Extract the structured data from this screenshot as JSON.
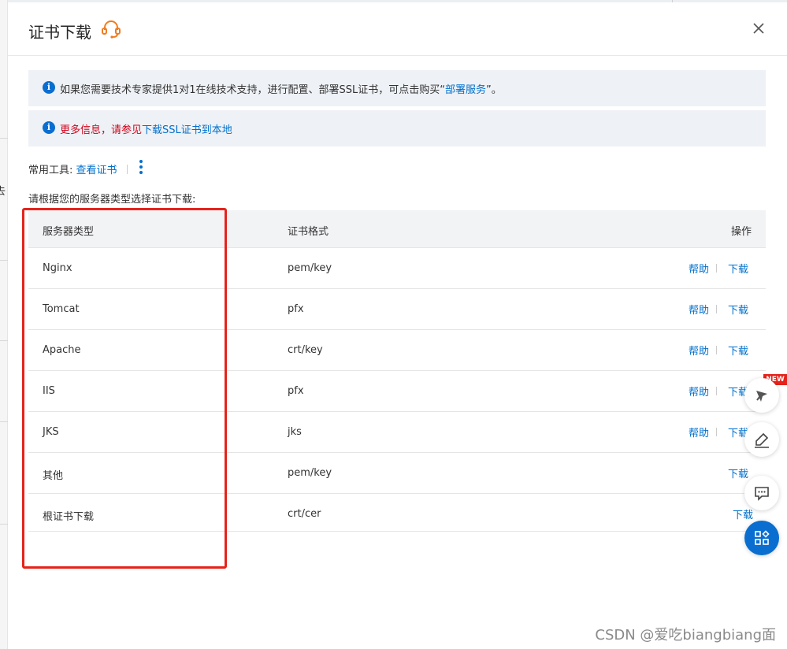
{
  "dialog": {
    "title": "证书下载",
    "notices": [
      {
        "prefix": "如果您需要技术专家提供1对1在线技术支持，进行配置、部署SSL证书，可点击购买“",
        "link": "部署服务",
        "suffix": "”。"
      },
      {
        "prefix": "更多信息，请参见",
        "link": "下载SSL证书到本地"
      }
    ],
    "tools": {
      "label": "常用工具:",
      "view_cert": "查看证书"
    },
    "instruction": "请根据您的服务器类型选择证书下载:"
  },
  "table": {
    "headers": {
      "server_type": "服务器类型",
      "format": "证书格式",
      "action": "操作"
    },
    "rows": [
      {
        "type": "Nginx",
        "format": "pem/key",
        "help": "帮助",
        "download": "下载"
      },
      {
        "type": "Tomcat",
        "format": "pfx",
        "help": "帮助",
        "download": "下载"
      },
      {
        "type": "Apache",
        "format": "crt/key",
        "help": "帮助",
        "download": "下载"
      },
      {
        "type": "IIS",
        "format": "pfx",
        "help": "帮助",
        "download": "下载"
      },
      {
        "type": "JKS",
        "format": "jks",
        "help": "帮助",
        "download": "下载"
      },
      {
        "type": "其他",
        "format": "pem/key",
        "download": "下载"
      },
      {
        "type": "根证书下载",
        "format": "crt/cer",
        "download": "下载"
      }
    ]
  },
  "floating_toolbar": {
    "new_badge": "NEW"
  },
  "background": {
    "partial_char": "去"
  },
  "watermark": "CSDN @爱吃biangbiang面"
}
